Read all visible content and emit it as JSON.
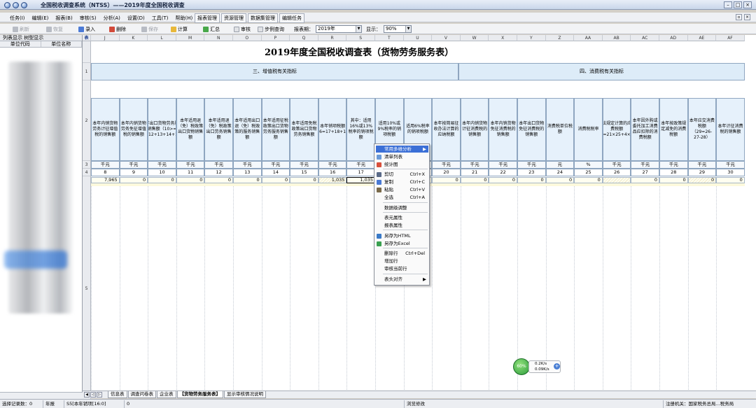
{
  "window": {
    "title": "全国税收调查系统（NTSS）——2019年度全国税收调查"
  },
  "menu": {
    "items": [
      "任务(I)",
      "编辑(E)",
      "报表(B)",
      "审核(S)",
      "分析(A)",
      "设置(D)",
      "工具(T)",
      "帮助(H)"
    ],
    "segments": [
      "报表管理",
      "资源管理",
      "数据集管理",
      "编辑任务"
    ]
  },
  "toolbar": {
    "refresh": "刷新",
    "reset": "恢复",
    "input": "录入",
    "delete": "删除",
    "save": "保存",
    "calc": "计算",
    "summary": "汇总",
    "audit": "审核",
    "step_query": "步例查询",
    "period_label": "报表期：",
    "period_value": "2019年",
    "display_label": "显示：",
    "display_value": "90%"
  },
  "left_panel": {
    "tabs": "列表显示   树型显示",
    "col_code": "单位代码",
    "col_name": "单位名称"
  },
  "grid": {
    "corner": "表",
    "columns": [
      "J",
      "K",
      "L",
      "M",
      "N",
      "O",
      "P",
      "Q",
      "R",
      "S",
      "T",
      "U",
      "V",
      "W",
      "X",
      "Y",
      "Z",
      "AA",
      "AB",
      "AC",
      "AD",
      "AE",
      "AF"
    ],
    "rows": [
      "1",
      "2",
      "3",
      "4",
      "5",
      "6"
    ]
  },
  "sheet": {
    "title": "2019年度全国税收调查表（货物劳务服务表）",
    "section3": "三、增值税有关指标",
    "section4": "四、消费税有关指标",
    "headers": [
      "本年内销货物劳务计征增值税的销售额",
      "本年内销货物劳务免征增值税的销售额",
      "本年出口货物劳务服务销售额（10>= 11+12+13+14+15）",
      "本年适用退（免）税政策出口货物销售额",
      "本年适用退（免）税政策出口劳务销售额",
      "本年适用出口退（免）税政策的服务销售额",
      "本年适用征税政策出口货物劳务服务销售额",
      "本年适用免税政策出口货物劳务销售额",
      "本年销项税额（16=17+18+19）",
      "其中：适用16%或13%税率的销项税额",
      "适用10%或9%税率的销项税额",
      "适用6%税率的销项税额",
      "本年按简易征收办法计算的应纳税额",
      "本年内销货物计征消费税的销售额",
      "本年内销货物免征消费税的销售额",
      "本年出口货物免征消费税的销售额",
      "消费税单位税额",
      "消费税税率",
      "按税法规定计算的应交消费税额（26=21×25+4×24）",
      "本年因外购或委托加工消费品应扣除的消费税额",
      "本年按政策规定减免的消费税额",
      "本年应交消费税额（29=26-27-28）",
      "本年计征消费税的销售额"
    ],
    "units": [
      "千元",
      "千元",
      "千元",
      "千元",
      "千元",
      "千元",
      "千元",
      "千元",
      "千元",
      "千元",
      "千元",
      "千元",
      "千元",
      "千元",
      "千元",
      "千元",
      "元",
      "%",
      "千元",
      "千元",
      "千元",
      "千元",
      "千元"
    ],
    "col_numbers": [
      "8",
      "9",
      "10",
      "11",
      "12",
      "13",
      "14",
      "15",
      "16",
      "17",
      "18",
      "19",
      "20",
      "21",
      "22",
      "23",
      "24",
      "25",
      "26",
      "27",
      "28",
      "29",
      "30"
    ],
    "data_row": [
      "7,965",
      "0",
      "0",
      "0",
      "0",
      "0",
      "0",
      "0",
      "1,035",
      "1,035",
      "",
      "",
      "0",
      "0",
      "0",
      "0",
      "0",
      "0",
      "",
      "0",
      "0",
      "0",
      "0"
    ],
    "total_row": [
      "7,965",
      "0",
      "0",
      "0",
      "0",
      "0",
      "0",
      "0",
      "1,035",
      "1,035",
      "0",
      "0",
      "0",
      "0",
      "0",
      "0",
      ".00",
      "0",
      "0",
      "0",
      "0",
      "0",
      "0"
    ]
  },
  "context_menu": {
    "items": [
      {
        "label": "常用多维分析",
        "key": "",
        "submenu": true
      },
      {
        "label": "清单列表",
        "key": ""
      },
      {
        "label": "统计图",
        "key": ""
      },
      {
        "label": "剪切",
        "key": "Ctrl+X"
      },
      {
        "label": "复制",
        "key": "Ctrl+C"
      },
      {
        "label": "粘贴",
        "key": "Ctrl+V"
      },
      {
        "label": "全选",
        "key": "Ctrl+A"
      },
      {
        "label": "数据级调整",
        "key": ""
      },
      {
        "label": "表元属性",
        "key": ""
      },
      {
        "label": "报表属性",
        "key": ""
      },
      {
        "label": "另存为HTML",
        "key": ""
      },
      {
        "label": "另存为Excel",
        "key": ""
      },
      {
        "label": "删除行",
        "key": "Ctrl+Del"
      },
      {
        "label": "增加行",
        "key": ""
      },
      {
        "label": "审核当前行",
        "key": ""
      },
      {
        "label": "表头对齐",
        "key": "",
        "submenu": true
      }
    ]
  },
  "net_widget": {
    "percent": "60%",
    "up": "0.2K/s",
    "down": "0.09K/s"
  },
  "sheet_tabs": [
    "信息表",
    "调查问卷表",
    "企业表",
    "【货物劳务服务表】",
    "显示审核情况说明"
  ],
  "status": {
    "records": "选择记录数：0",
    "mode": "年报",
    "cell": "S5[本年销项[16:0]",
    "value": "0",
    "state": "浏览修改",
    "machine": "注册机关：国家税务总局...税务局"
  }
}
